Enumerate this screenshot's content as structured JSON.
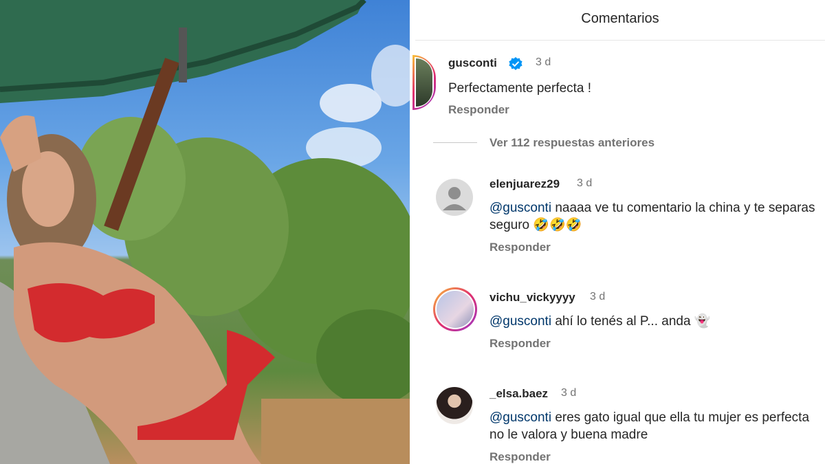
{
  "header": {
    "title": "Comentarios"
  },
  "comments": [
    {
      "user": "gusconti",
      "time": "3 d",
      "text": "Perfectamente perfecta !",
      "reply": "Responder",
      "verified": true
    },
    {
      "user": "elenjuarez29",
      "time": "3 d",
      "mention": "@gusconti",
      "text": " naaaa ve tu comentario la china y te separas seguro 🤣🤣🤣",
      "reply": "Responder"
    },
    {
      "user": "vichu_vickyyyy",
      "time": "3 d",
      "mention": "@gusconti",
      "text": " ahí lo tenés al P... anda 👻",
      "reply": "Responder"
    },
    {
      "user": "_elsa.baez",
      "time": "3 d",
      "mention": "@gusconti",
      "text": " eres gato igual que ella tu mujer es perfecta no le valora  y buena madre",
      "reply": "Responder"
    }
  ],
  "more_replies": "Ver 112 respuestas anteriores",
  "colors": {
    "text": "#262626",
    "muted": "#737373",
    "mention": "#00376b",
    "verified": "#0095f6"
  }
}
